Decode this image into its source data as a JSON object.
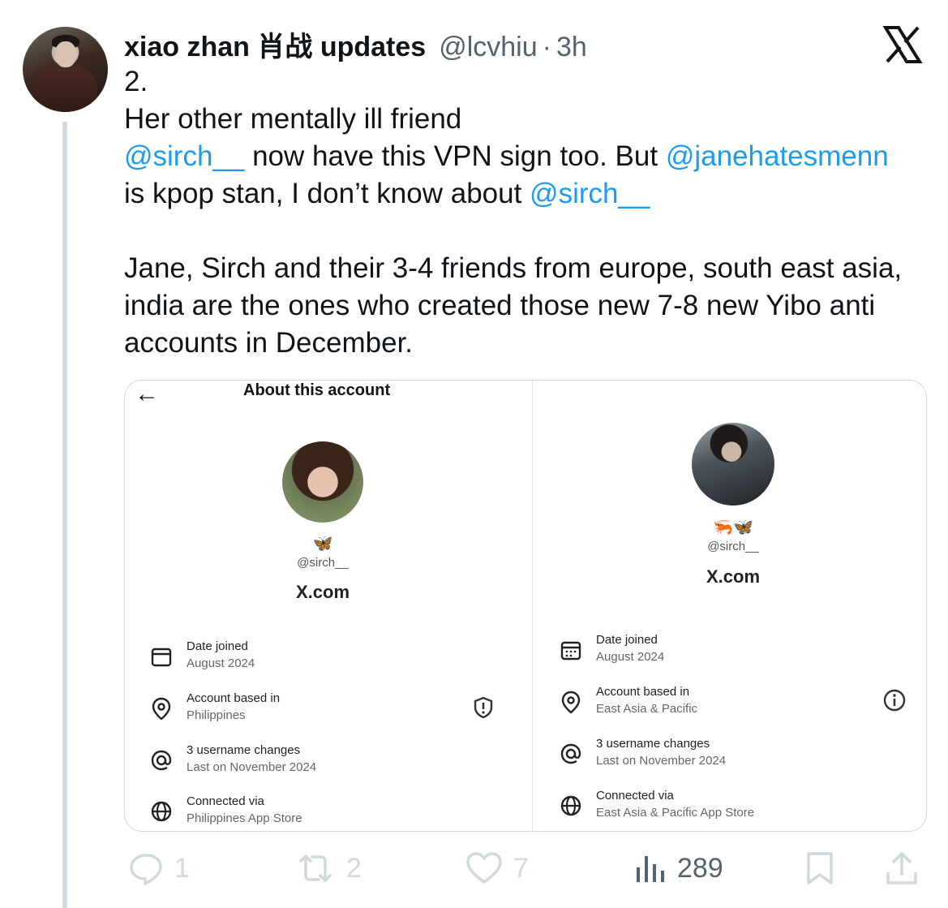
{
  "tweet": {
    "author_name": "xiao zhan 肖战 updates",
    "handle": "@lcvhiu",
    "separator": "·",
    "time": "3h",
    "line1": "2.",
    "line2": "Her other mentally ill friend",
    "mention_sirch": "@sirch__",
    "text_vpn": " now have this VPN sign too. But ",
    "mention_jane": "@janehatesmenn",
    "text_kpop": "is kpop stan, I don’t know about ",
    "mention_sirch2": "@sirch__",
    "para2": "Jane, Sirch and their 3-4 friends from europe, south east asia, india are the ones who created those new 7-8 new Yibo anti accounts in December."
  },
  "card": {
    "left": {
      "back_icon": "arrow-left-icon",
      "title": "About this account",
      "emoji": "🦋",
      "handle": "@sirch__",
      "site": "X.com",
      "rows": [
        {
          "label": "Date joined",
          "value": "August 2024",
          "icon": "calendar-icon"
        },
        {
          "label": "Account based in",
          "value": "Philippines",
          "icon": "location-pin-icon"
        },
        {
          "label": "3 username changes",
          "value": "Last on November 2024",
          "icon": "at-sign-icon"
        },
        {
          "label": "Connected via",
          "value": "Philippines App Store",
          "icon": "globe-icon"
        }
      ],
      "side_icon": "shield-alert-icon"
    },
    "right": {
      "emoji": "🦐🦋",
      "handle": "@sirch__",
      "site": "X.com",
      "rows": [
        {
          "label": "Date joined",
          "value": "August 2024",
          "icon": "calendar-icon"
        },
        {
          "label": "Account based in",
          "value": "East Asia & Pacific",
          "icon": "location-pin-icon"
        },
        {
          "label": "3 username changes",
          "value": "Last on November 2024",
          "icon": "at-sign-icon"
        },
        {
          "label": "Connected via",
          "value": "East Asia & Pacific App Store",
          "icon": "globe-icon"
        }
      ],
      "side_icon": "info-icon"
    }
  },
  "actions": {
    "replies": "1",
    "reposts": "2",
    "likes": "7",
    "views": "289"
  },
  "colors": {
    "link": "#1d9bf0",
    "muted": "#536471",
    "border": "#cfd9de"
  }
}
